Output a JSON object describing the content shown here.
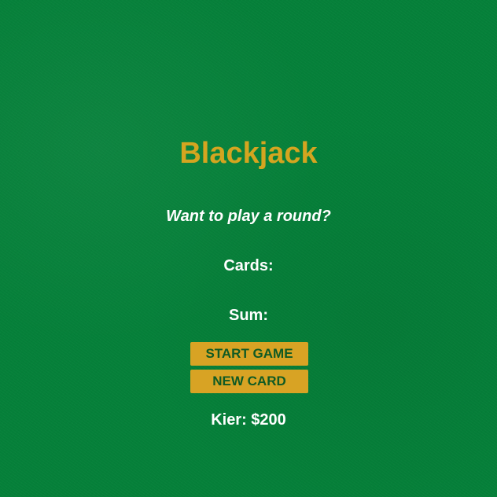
{
  "game": {
    "title": "Blackjack",
    "message": "Want to play a round?",
    "cards_label": "Cards:",
    "sum_label": "Sum:",
    "buttons": {
      "start": "START GAME",
      "new_card": "NEW CARD"
    },
    "player": "Kier: $200"
  },
  "colors": {
    "felt": "#058039",
    "title": "#d4a520",
    "button_bg": "#d8a324",
    "button_text": "#0f5a24",
    "text": "#ffffff"
  }
}
